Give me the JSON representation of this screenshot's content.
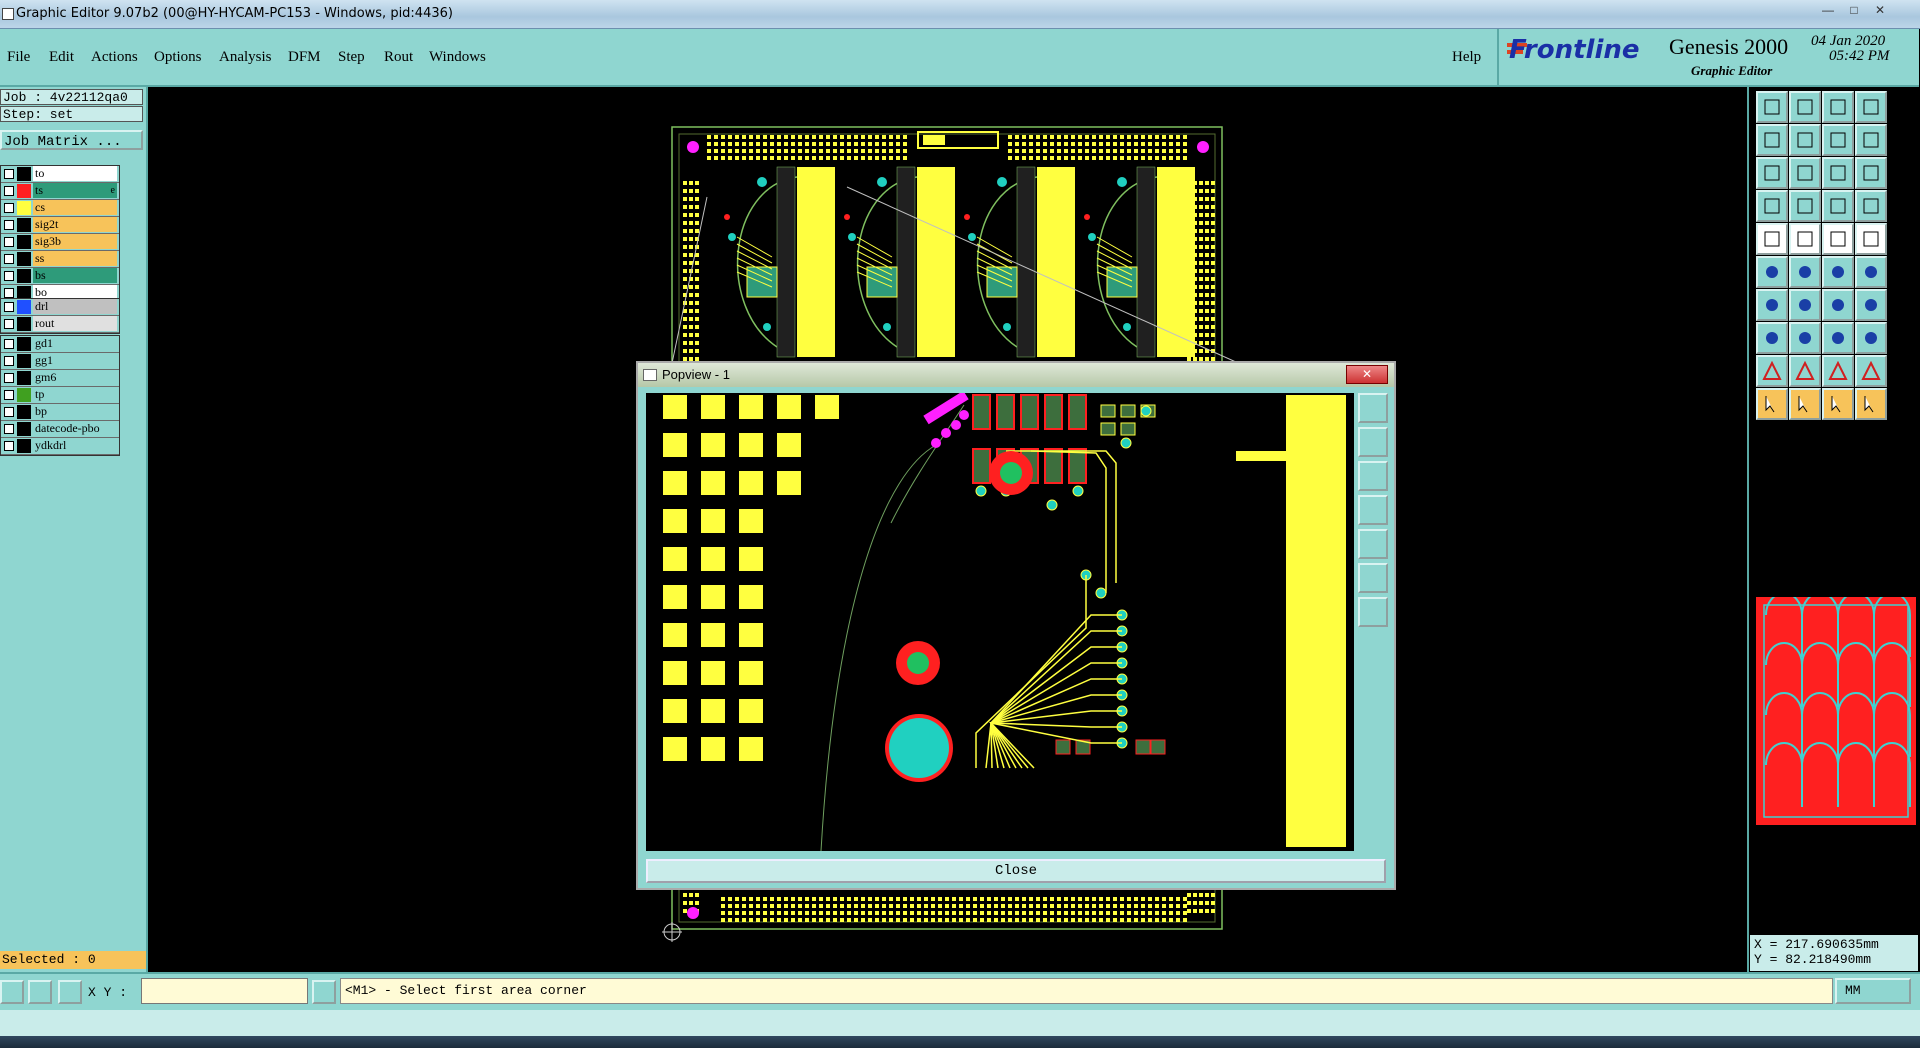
{
  "window": {
    "title": "Graphic Editor 9.07b2 (00@HY-HYCAM-PC153 - Windows, pid:4436)"
  },
  "menu": [
    "File",
    "Edit",
    "Actions",
    "Options",
    "Analysis",
    "DFM",
    "Step",
    "Rout",
    "Windows"
  ],
  "help": "Help",
  "logo": {
    "brand": "Frontline",
    "product": "Genesis 2000",
    "subtitle": "Graphic Editor",
    "date": "04 Jan 2020",
    "time": "05:42 PM"
  },
  "job": {
    "job_line": "Job : 4v22112qa0",
    "step_line": "Step: set",
    "matrix_button": "Job Matrix ..."
  },
  "layers_group1": [
    {
      "name": "to",
      "color": "#000000",
      "bg": "#ffffff"
    },
    {
      "name": "ts",
      "color": "#ff2020",
      "bg": "#2e9b7a",
      "marker": "e"
    },
    {
      "name": "cs",
      "color": "#ffff40",
      "bg": "#f7c35a"
    },
    {
      "name": "sig2t",
      "color": "#000000",
      "bg": "#f7c35a"
    },
    {
      "name": "sig3b",
      "color": "#000000",
      "bg": "#f7c35a"
    },
    {
      "name": "ss",
      "color": "#000000",
      "bg": "#f7c35a"
    },
    {
      "name": "bs",
      "color": "#000000",
      "bg": "#2e9b7a"
    },
    {
      "name": "bo",
      "color": "#000000",
      "bg": "#ffffff"
    }
  ],
  "layers_group2": [
    {
      "name": "drl",
      "color": "#2050ff",
      "bg": "#c0c0c0"
    },
    {
      "name": "rout",
      "color": "#000000",
      "bg": "#e0e0e0"
    }
  ],
  "layers_group3": [
    {
      "name": "gd1",
      "color": "#000000",
      "bg": "#8fd6d0"
    },
    {
      "name": "gg1",
      "color": "#000000",
      "bg": "#8fd6d0"
    },
    {
      "name": "gm6",
      "color": "#000000",
      "bg": "#8fd6d0"
    },
    {
      "name": "tp",
      "color": "#40a020",
      "bg": "#8fd6d0"
    },
    {
      "name": "bp",
      "color": "#000000",
      "bg": "#8fd6d0"
    },
    {
      "name": "datecode-pbo",
      "color": "#000000",
      "bg": "#8fd6d0"
    },
    {
      "name": "ydkdrl",
      "color": "#000000",
      "bg": "#8fd6d0"
    }
  ],
  "selected": "Selected : 0",
  "popview": {
    "title": "Popview - 1",
    "close": "Close"
  },
  "bottom": {
    "xy_label": "X Y :",
    "prompt": "<M1> - Select first area corner",
    "units": "MM"
  },
  "coords": {
    "x": "X = 217.690635mm",
    "y": "Y = 82.218490mm"
  },
  "colors": {
    "panel": "#8fd6d0",
    "accent": "#f7c35a",
    "pad": "#ffff40",
    "board_outline": "#7fbf5f"
  }
}
